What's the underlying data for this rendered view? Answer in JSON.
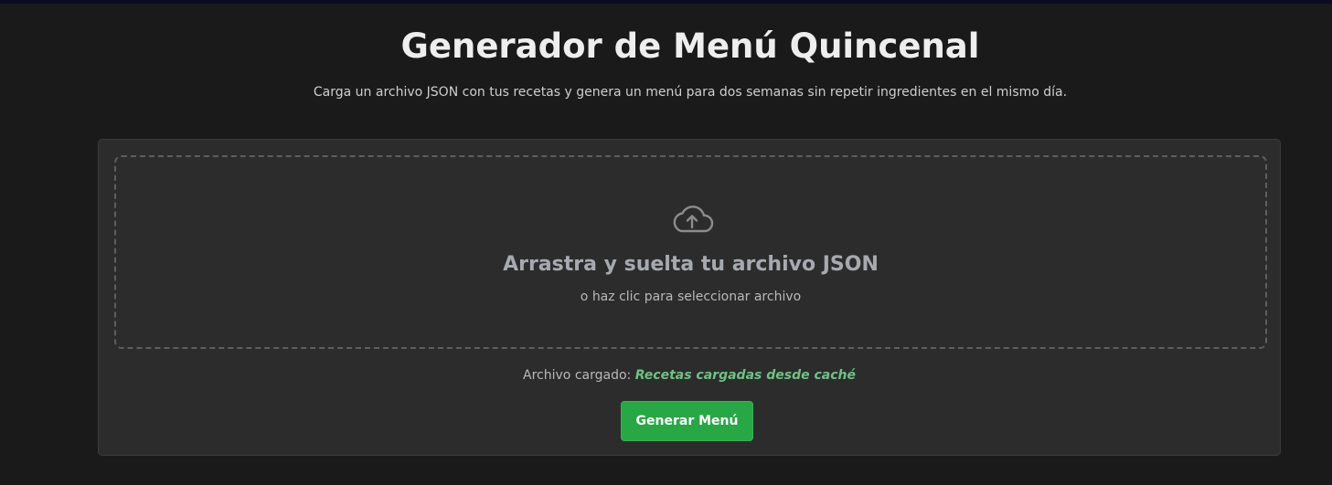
{
  "header": {
    "title": "Generador de Menú Quincenal",
    "subtitle": "Carga un archivo JSON con tus recetas y genera un menú para dos semanas sin repetir ingredientes en el mismo día."
  },
  "dropzone": {
    "icon": "cloud-upload-icon",
    "title": "Arrastra y suelta tu archivo JSON",
    "hint": "o haz clic para seleccionar archivo"
  },
  "file_status": {
    "label": "Archivo cargado:",
    "value": "Recetas cargadas desde caché"
  },
  "actions": {
    "generate_label": "Generar Menú"
  },
  "colors": {
    "background": "#1a1a1a",
    "card": "#2c2c2c",
    "accent_green": "#28a745",
    "status_green": "#6cc383"
  }
}
